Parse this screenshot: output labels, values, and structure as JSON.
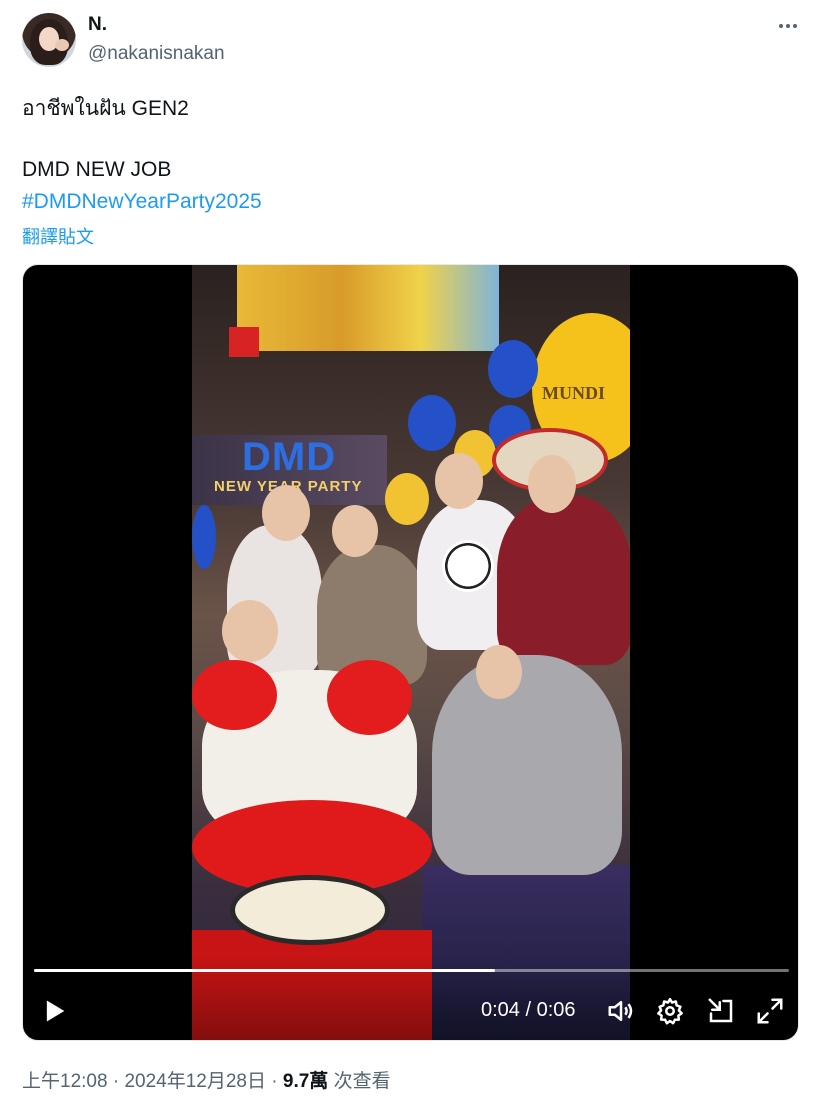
{
  "author": {
    "name": "N.",
    "handle": "@nakanisnakan"
  },
  "tweet": {
    "line1": "อาชีพในฝัน GEN2",
    "line2": "DMD NEW JOB",
    "hashtag": "#DMDNewYearParty2025",
    "translate_label": "翻譯貼文"
  },
  "video": {
    "scene_sign": "DMD",
    "scene_subsign": "NEW YEAR PARTY",
    "scene_balloon_text": "MUNDI",
    "current_time": "0:04",
    "separator": "/",
    "duration": "0:06",
    "progress_fraction": 0.61
  },
  "meta": {
    "time": "上午12:08",
    "dot1": "·",
    "date": "2024年12月28日",
    "dot2": "·",
    "views_count": "9.7萬",
    "views_label": "次查看"
  },
  "colors": {
    "link": "#1d9bf0",
    "secondary_text": "#536471",
    "primary_text": "#0f1419"
  }
}
